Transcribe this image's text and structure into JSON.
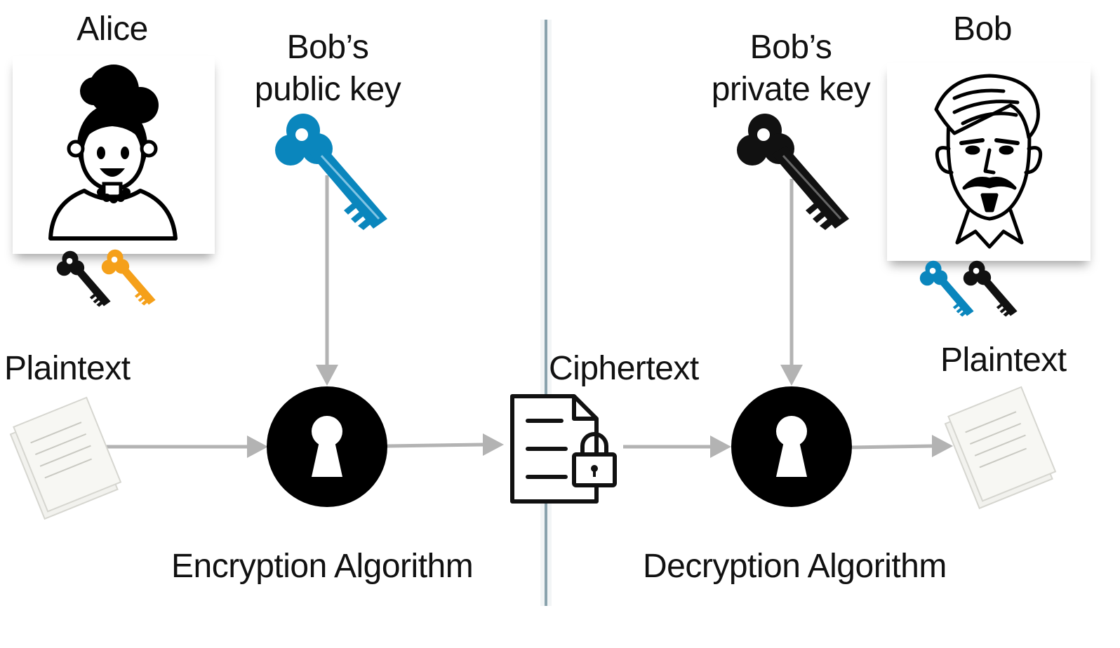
{
  "alice": {
    "name": "Alice"
  },
  "bob": {
    "name": "Bob"
  },
  "public_key": {
    "line1": "Bob’s",
    "line2": "public key"
  },
  "private_key": {
    "line1": "Bob’s",
    "line2": "private key"
  },
  "plaintext_left": "Plaintext",
  "plaintext_right": "Plaintext",
  "ciphertext": "Ciphertext",
  "encryption": "Encryption Algorithm",
  "decryption": "Decryption Algorithm",
  "colors": {
    "public_key_blue": "#0a86bd",
    "alice_key_orange": "#f5a01a",
    "private_key_black": "#111111",
    "arrow_gray": "#b3b3b3",
    "divider": "#8aa3ad"
  }
}
